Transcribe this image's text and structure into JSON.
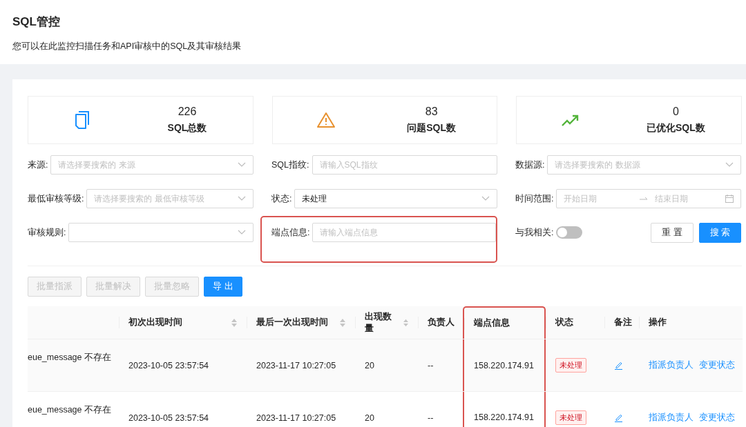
{
  "header": {
    "title": "SQL管控",
    "subtitle": "您可以在此监控扫描任务和API审核中的SQL及其审核结果"
  },
  "stats": [
    {
      "kind": "docs",
      "value": "226",
      "label": "SQL总数"
    },
    {
      "kind": "warning",
      "value": "83",
      "label": "问题SQL数"
    },
    {
      "kind": "trend",
      "value": "0",
      "label": "已优化SQL数"
    }
  ],
  "filters": [
    {
      "kind": "select",
      "label": "来源:",
      "placeholder": "请选择要搜索的 来源",
      "highlighted": false
    },
    {
      "kind": "input",
      "label": "SQL指纹:",
      "placeholder": "请输入SQL指纹",
      "highlighted": false
    },
    {
      "kind": "select",
      "label": "数据源:",
      "placeholder": "请选择要搜索的 数据源",
      "highlighted": false
    },
    {
      "kind": "select",
      "label": "最低审核等级:",
      "placeholder": "请选择要搜索的 最低审核等级",
      "highlighted": false
    },
    {
      "kind": "select",
      "label": "状态:",
      "value": "未处理",
      "highlighted": false
    },
    {
      "kind": "daterange",
      "label": "时间范围:",
      "start_placeholder": "开始日期",
      "end_placeholder": "结束日期",
      "highlighted": false
    },
    {
      "kind": "select",
      "label": "审核规则:",
      "highlighted": false
    },
    {
      "kind": "input",
      "label": "端点信息:",
      "placeholder": "请输入端点信息",
      "highlighted": true
    },
    {
      "kind": "switch",
      "label": "与我相关:",
      "on": false,
      "highlighted": false
    }
  ],
  "form_buttons": [
    {
      "label": "重 置",
      "primary": false
    },
    {
      "label": "搜 索",
      "primary": true
    }
  ],
  "toolbar": [
    {
      "label": "批量指派",
      "disabled": true,
      "primary": false
    },
    {
      "label": "批量解决",
      "disabled": true,
      "primary": false
    },
    {
      "label": "批量忽略",
      "disabled": true,
      "primary": false
    },
    {
      "label": "导 出",
      "disabled": false,
      "primary": true
    }
  ],
  "table": {
    "columns": [
      {
        "sortable": false,
        "highlighted": false
      },
      {
        "label": "初次出现时间",
        "sortable": true,
        "highlighted": false
      },
      {
        "label": "最后一次出现时间",
        "sortable": true,
        "highlighted": false
      },
      {
        "label": "出现数量",
        "sortable": true,
        "highlighted": false
      },
      {
        "label": "负责人",
        "sortable": false,
        "highlighted": false
      },
      {
        "label": "端点信息",
        "sortable": false,
        "highlighted": true
      },
      {
        "label": "状态",
        "sortable": false,
        "highlighted": false
      },
      {
        "label": "备注",
        "sortable": false,
        "highlighted": false
      },
      {
        "label": "操作",
        "sortable": false,
        "highlighted": false
      }
    ],
    "rows": [
      {
        "column_1": "eue_message 不存在",
        "first_seen": "2023-10-05 23:57:54",
        "last_seen": "2023-11-17 10:27:05",
        "count": "20",
        "owner": "--",
        "endpoint": "158.220.174.91",
        "status": "未处理",
        "actions": [
          "指派负责人",
          "变更状态"
        ]
      },
      {
        "column_1": "eue_message 不存在",
        "first_seen": "2023-10-05 23:57:54",
        "last_seen": "2023-11-17 10:27:05",
        "count": "20",
        "owner": "--",
        "endpoint": "158.220.174.91",
        "status": "未处理",
        "actions": [
          "指派负责人",
          "变更状态"
        ]
      }
    ]
  }
}
